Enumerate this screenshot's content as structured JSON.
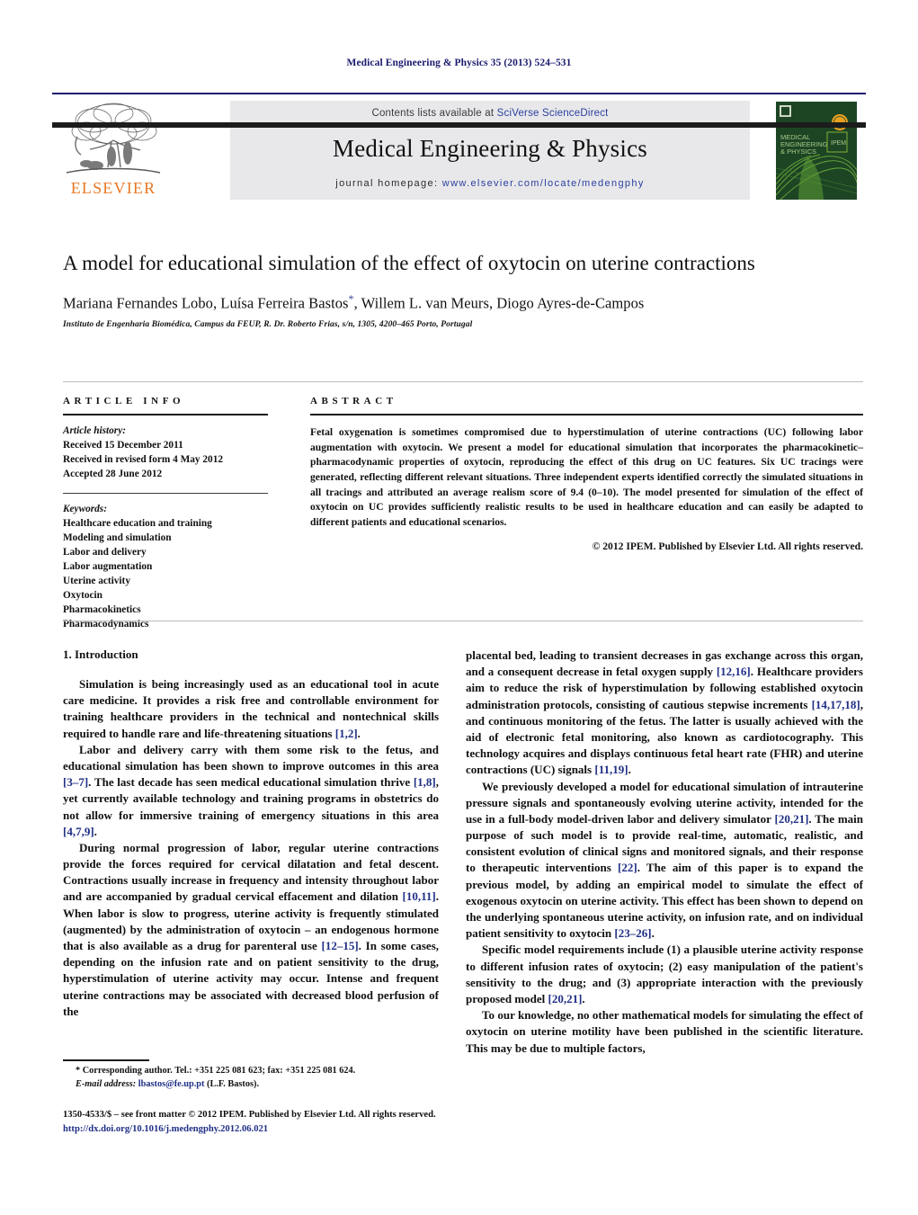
{
  "running_head": "Medical Engineering & Physics 35 (2013) 524–531",
  "masthead": {
    "contents_prefix": "Contents lists available at ",
    "sciencedirect": "SciVerse ScienceDirect",
    "journal_title": "Medical Engineering & Physics",
    "homepage_prefix": "journal homepage: ",
    "homepage_url": "www.elsevier.com/locate/medengphy",
    "publisher_wordmark": "ELSEVIER",
    "cover_title_line1": "MEDICAL",
    "cover_title_line2": "ENGINEERING",
    "cover_title_line3": "& PHYSICS",
    "accent_orange": "#e87722",
    "link_blue": "#2b3fa0",
    "band_gray": "#e8e8ea",
    "cover_green_dark": "#1d4524",
    "cover_green_light": "#8dc63f"
  },
  "article": {
    "title": "A model for educational simulation of the effect of oxytocin on uterine contractions",
    "authors": "Mariana Fernandes Lobo, Luísa Ferreira Bastos",
    "authors_tail": ", Willem L. van Meurs, Diogo Ayres-de-Campos",
    "corresponding_marker": "*",
    "affiliation": "Instituto de Engenharia Biomédica, Campus da FEUP, R. Dr. Roberto Frias, s/n, 1305, 4200–465 Porto, Portugal"
  },
  "article_info": {
    "heading": "ARTICLE INFO",
    "history_label": "Article history:",
    "history": [
      "Received 15 December 2011",
      "Received in revised form 4 May 2012",
      "Accepted 28 June 2012"
    ],
    "keywords_label": "Keywords:",
    "keywords": [
      "Healthcare education and training",
      "Modeling and simulation",
      "Labor and delivery",
      "Labor augmentation",
      "Uterine activity",
      "Oxytocin",
      "Pharmacokinetics",
      "Pharmacodynamics"
    ]
  },
  "abstract": {
    "heading": "ABSTRACT",
    "text": "Fetal oxygenation is sometimes compromised due to hyperstimulation of uterine contractions (UC) following labor augmentation with oxytocin. We present a model for educational simulation that incorporates the pharmacokinetic–pharmacodynamic properties of oxytocin, reproducing the effect of this drug on UC features. Six UC tracings were generated, reflecting different relevant situations. Three independent experts identified correctly the simulated situations in all tracings and attributed an average realism score of 9.4 (0–10). The model presented for simulation of the effect of oxytocin on UC provides sufficiently realistic results to be used in healthcare education and can easily be adapted to different patients and educational scenarios.",
    "copyright": "© 2012 IPEM. Published by Elsevier Ltd. All rights reserved."
  },
  "body": {
    "section_heading": "1. Introduction",
    "left_paragraphs": [
      "Simulation is being increasingly used as an educational tool in acute care medicine. It provides a risk free and controllable environment for training healthcare providers in the technical and nontechnical skills required to handle rare and life-threatening situations [1,2].",
      "Labor and delivery carry with them some risk to the fetus, and educational simulation has been shown to improve outcomes in this area [3–7]. The last decade has seen medical educational simulation thrive [1,8], yet currently available technology and training programs in obstetrics do not allow for immersive training of emergency situations in this area [4,7,9].",
      "During normal progression of labor, regular uterine contractions provide the forces required for cervical dilatation and fetal descent. Contractions usually increase in frequency and intensity throughout labor and are accompanied by gradual cervical effacement and dilation [10,11]. When labor is slow to progress, uterine activity is frequently stimulated (augmented) by the administration of oxytocin – an endogenous hormone that is also available as a drug for parenteral use [12–15]. In some cases, depending on the infusion rate and on patient sensitivity to the drug, hyperstimulation of uterine activity may occur. Intense and frequent uterine contractions may be associated with decreased blood perfusion of the"
    ],
    "right_paragraphs": [
      "placental bed, leading to transient decreases in gas exchange across this organ, and a consequent decrease in fetal oxygen supply [12,16]. Healthcare providers aim to reduce the risk of hyperstimulation by following established oxytocin administration protocols, consisting of cautious stepwise increments [14,17,18], and continuous monitoring of the fetus. The latter is usually achieved with the aid of electronic fetal monitoring, also known as cardiotocography. This technology acquires and displays continuous fetal heart rate (FHR) and uterine contractions (UC) signals [11,19].",
      "We previously developed a model for educational simulation of intrauterine pressure signals and spontaneously evolving uterine activity, intended for the use in a full-body model-driven labor and delivery simulator [20,21]. The main purpose of such model is to provide real-time, automatic, realistic, and consistent evolution of clinical signs and monitored signals, and their response to therapeutic interventions [22]. The aim of this paper is to expand the previous model, by adding an empirical model to simulate the effect of exogenous oxytocin on uterine activity. This effect has been shown to depend on the underlying spontaneous uterine activity, on infusion rate, and on individual patient sensitivity to oxytocin [23–26].",
      "Specific model requirements include (1) a plausible uterine activity response to different infusion rates of oxytocin; (2) easy manipulation of the patient's sensitivity to the drug; and (3) appropriate interaction with the previously proposed model [20,21].",
      "To our knowledge, no other mathematical models for simulating the effect of oxytocin on uterine motility have been published in the scientific literature. This may be due to multiple factors,"
    ]
  },
  "footnote": {
    "corresponding": "* Corresponding author. Tel.: +351 225 081 623; fax: +351 225 081 624.",
    "email_label": "E-mail address:",
    "email": "lbastos@fe.up.pt",
    "email_suffix": "(L.F. Bastos)."
  },
  "colophon": {
    "line1": "1350-4533/$ – see front matter © 2012 IPEM. Published by Elsevier Ltd. All rights reserved.",
    "doi": "http://dx.doi.org/10.1016/j.medengphy.2012.06.021"
  }
}
